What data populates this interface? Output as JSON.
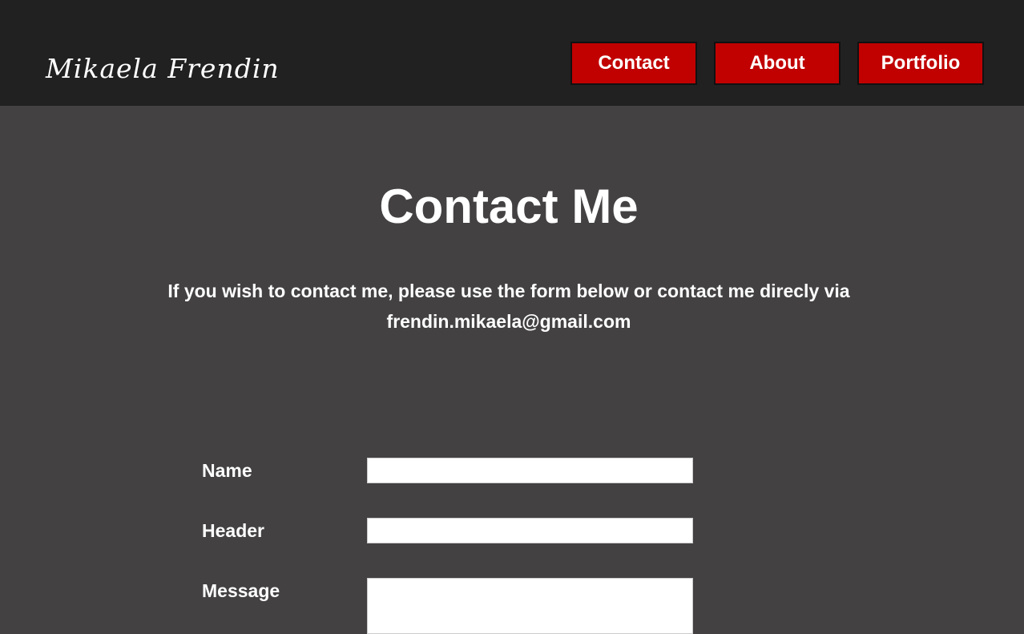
{
  "site": {
    "logo_text": "Mikaela Frendin"
  },
  "nav": {
    "items": [
      {
        "label": "Contact"
      },
      {
        "label": "About"
      },
      {
        "label": "Portfolio"
      }
    ]
  },
  "main": {
    "title": "Contact Me",
    "intro_line1": "If you wish to contact me, please use the form below or contact me direcly via",
    "intro_line2": "frendin.mikaela@gmail.com"
  },
  "form": {
    "name_label": "Name",
    "name_value": "",
    "header_label": "Header",
    "header_value": "",
    "message_label": "Message",
    "message_value": ""
  },
  "colors": {
    "header_bg": "#212121",
    "page_bg": "#434142",
    "accent": "#c10000",
    "text": "#ffffff"
  }
}
